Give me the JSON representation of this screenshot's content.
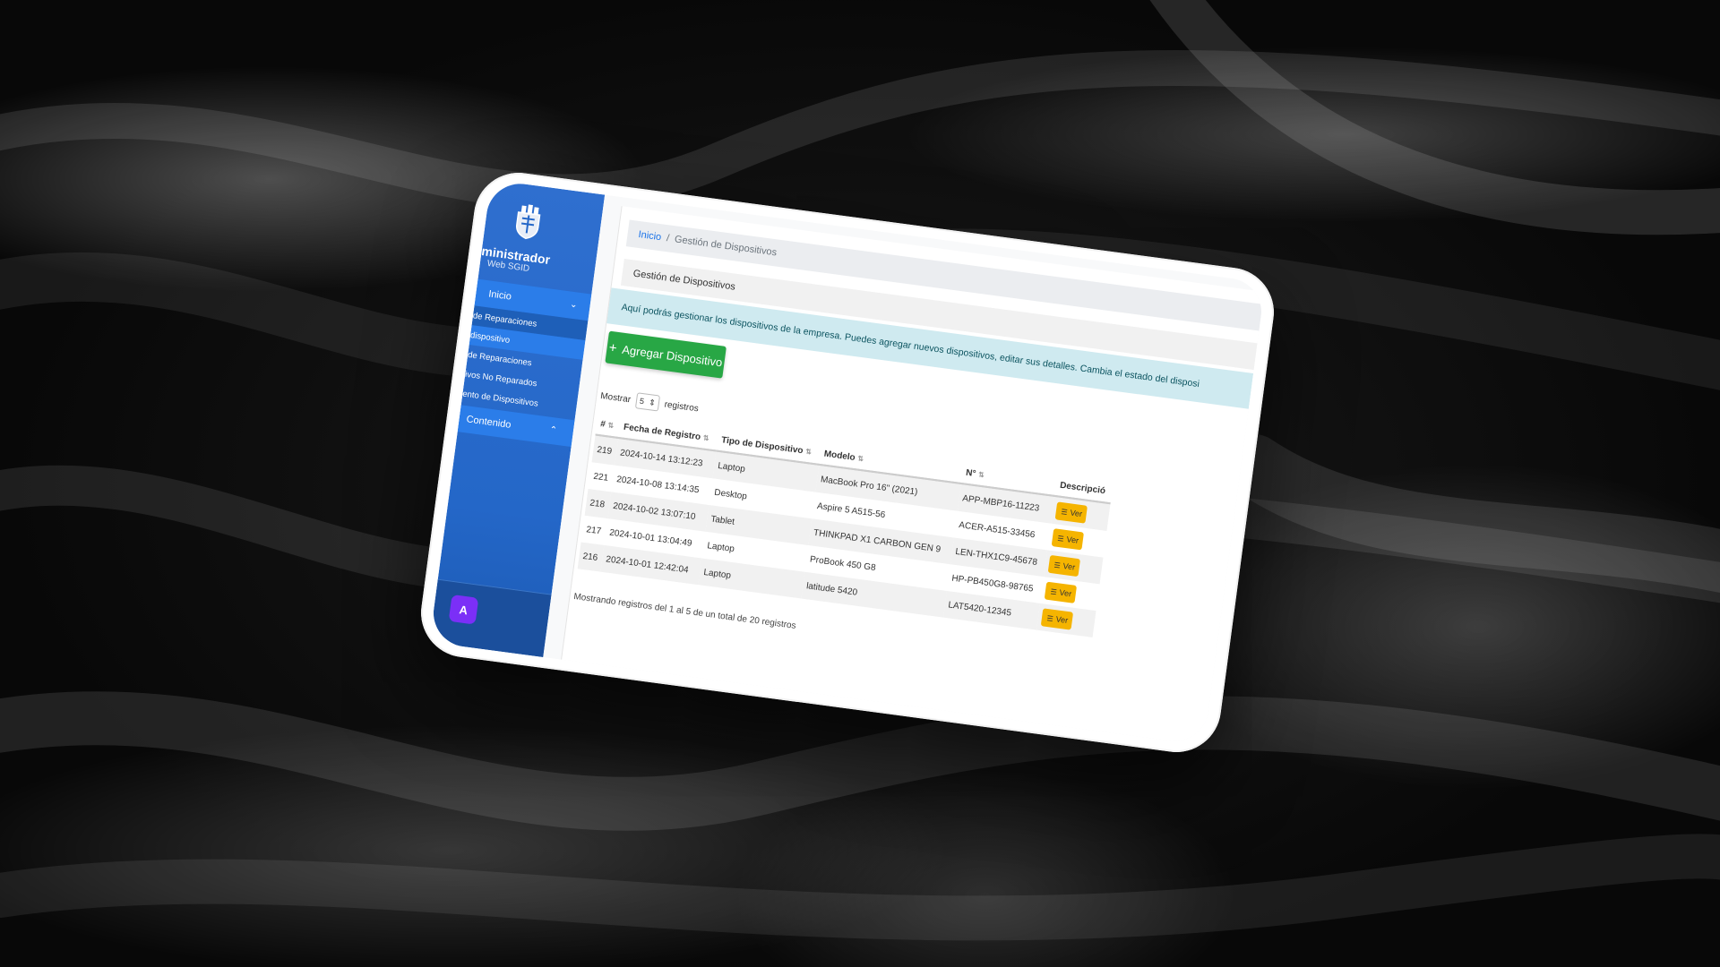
{
  "sidebar": {
    "brand_title": "ministrador",
    "brand_sub": "Web SGID",
    "nav_inicio": "Inicio",
    "sub_items": [
      "de Reparaciones",
      "dispositivo",
      "de Reparaciones",
      "ivos No Reparados",
      "ento de Dispositivos"
    ],
    "nav_contenido": "Contenido",
    "avatar_letter": "A"
  },
  "breadcrumb": {
    "home": "Inicio",
    "separator": "/",
    "current": "Gestión de Dispositivos"
  },
  "page": {
    "title": "Gestión de Dispositivos",
    "info": "Aquí podrás gestionar los dispositivos de la empresa. Puedes agregar nuevos dispositivos, editar sus detalles. Cambia el estado del disposi",
    "add_button": "Agregar Dispositivo"
  },
  "table_controls": {
    "show_label": "Mostrar",
    "page_size": "5",
    "records_label": "registros"
  },
  "table": {
    "headers": [
      "#",
      "Fecha de Registro",
      "Tipo de Dispositivo",
      "Modelo",
      "N°",
      "Descripció"
    ],
    "rows": [
      {
        "id": "219",
        "fecha": "2024-10-14 13:12:23",
        "tipo": "Laptop",
        "modelo": "MacBook Pro 16\" (2021)",
        "serie": "APP-MBP16-11223",
        "accion": "Ver"
      },
      {
        "id": "221",
        "fecha": "2024-10-08 13:14:35",
        "tipo": "Desktop",
        "modelo": "Aspire 5 A515-56",
        "serie": "ACER-A515-33456",
        "accion": "Ver"
      },
      {
        "id": "218",
        "fecha": "2024-10-02 13:07:10",
        "tipo": "Tablet",
        "modelo": "THINKPAD X1 CARBON GEN 9",
        "serie": "LEN-THX1C9-45678",
        "accion": "Ver"
      },
      {
        "id": "217",
        "fecha": "2024-10-01 13:04:49",
        "tipo": "Laptop",
        "modelo": "ProBook 450 G8",
        "serie": "HP-PB450G8-98765",
        "accion": "Ver"
      },
      {
        "id": "216",
        "fecha": "2024-10-01 12:42:04",
        "tipo": "Laptop",
        "modelo": "latitude 5420",
        "serie": "LAT5420-12345",
        "accion": "Ver"
      }
    ]
  },
  "footer": {
    "summary": "Mostrando registros del 1 al 5 de un total de 20 registros"
  },
  "colors": {
    "sidebar": "#2467c8",
    "sidebar_active": "#2b7de9",
    "add_button": "#28a745",
    "ver_button": "#f5b400",
    "info_bg": "#cfeaf0",
    "avatar": "#7b2ff7"
  },
  "icons": {
    "logo": "coat-of-arms-icon",
    "expand": "chevron-down-icon",
    "collapse": "chevron-up-icon",
    "add": "plus-icon",
    "sort": "sort-arrows-icon",
    "view": "list-icon",
    "page_size": "select-arrows-icon"
  }
}
